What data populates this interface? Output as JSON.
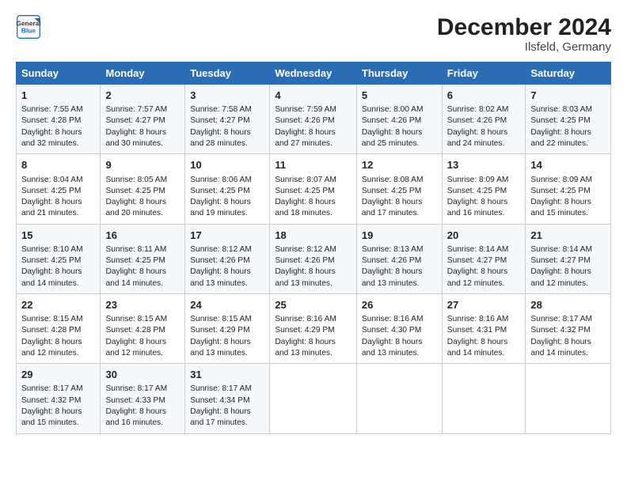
{
  "header": {
    "logo_line1": "General",
    "logo_line2": "Blue",
    "title": "December 2024",
    "subtitle": "Ilsfeld, Germany"
  },
  "calendar": {
    "days_of_week": [
      "Sunday",
      "Monday",
      "Tuesday",
      "Wednesday",
      "Thursday",
      "Friday",
      "Saturday"
    ],
    "weeks": [
      [
        {
          "day": "1",
          "lines": [
            "Sunrise: 7:55 AM",
            "Sunset: 4:28 PM",
            "Daylight: 8 hours",
            "and 32 minutes."
          ]
        },
        {
          "day": "2",
          "lines": [
            "Sunrise: 7:57 AM",
            "Sunset: 4:27 PM",
            "Daylight: 8 hours",
            "and 30 minutes."
          ]
        },
        {
          "day": "3",
          "lines": [
            "Sunrise: 7:58 AM",
            "Sunset: 4:27 PM",
            "Daylight: 8 hours",
            "and 28 minutes."
          ]
        },
        {
          "day": "4",
          "lines": [
            "Sunrise: 7:59 AM",
            "Sunset: 4:26 PM",
            "Daylight: 8 hours",
            "and 27 minutes."
          ]
        },
        {
          "day": "5",
          "lines": [
            "Sunrise: 8:00 AM",
            "Sunset: 4:26 PM",
            "Daylight: 8 hours",
            "and 25 minutes."
          ]
        },
        {
          "day": "6",
          "lines": [
            "Sunrise: 8:02 AM",
            "Sunset: 4:26 PM",
            "Daylight: 8 hours",
            "and 24 minutes."
          ]
        },
        {
          "day": "7",
          "lines": [
            "Sunrise: 8:03 AM",
            "Sunset: 4:25 PM",
            "Daylight: 8 hours",
            "and 22 minutes."
          ]
        }
      ],
      [
        {
          "day": "8",
          "lines": [
            "Sunrise: 8:04 AM",
            "Sunset: 4:25 PM",
            "Daylight: 8 hours",
            "and 21 minutes."
          ]
        },
        {
          "day": "9",
          "lines": [
            "Sunrise: 8:05 AM",
            "Sunset: 4:25 PM",
            "Daylight: 8 hours",
            "and 20 minutes."
          ]
        },
        {
          "day": "10",
          "lines": [
            "Sunrise: 8:06 AM",
            "Sunset: 4:25 PM",
            "Daylight: 8 hours",
            "and 19 minutes."
          ]
        },
        {
          "day": "11",
          "lines": [
            "Sunrise: 8:07 AM",
            "Sunset: 4:25 PM",
            "Daylight: 8 hours",
            "and 18 minutes."
          ]
        },
        {
          "day": "12",
          "lines": [
            "Sunrise: 8:08 AM",
            "Sunset: 4:25 PM",
            "Daylight: 8 hours",
            "and 17 minutes."
          ]
        },
        {
          "day": "13",
          "lines": [
            "Sunrise: 8:09 AM",
            "Sunset: 4:25 PM",
            "Daylight: 8 hours",
            "and 16 minutes."
          ]
        },
        {
          "day": "14",
          "lines": [
            "Sunrise: 8:09 AM",
            "Sunset: 4:25 PM",
            "Daylight: 8 hours",
            "and 15 minutes."
          ]
        }
      ],
      [
        {
          "day": "15",
          "lines": [
            "Sunrise: 8:10 AM",
            "Sunset: 4:25 PM",
            "Daylight: 8 hours",
            "and 14 minutes."
          ]
        },
        {
          "day": "16",
          "lines": [
            "Sunrise: 8:11 AM",
            "Sunset: 4:25 PM",
            "Daylight: 8 hours",
            "and 14 minutes."
          ]
        },
        {
          "day": "17",
          "lines": [
            "Sunrise: 8:12 AM",
            "Sunset: 4:26 PM",
            "Daylight: 8 hours",
            "and 13 minutes."
          ]
        },
        {
          "day": "18",
          "lines": [
            "Sunrise: 8:12 AM",
            "Sunset: 4:26 PM",
            "Daylight: 8 hours",
            "and 13 minutes."
          ]
        },
        {
          "day": "19",
          "lines": [
            "Sunrise: 8:13 AM",
            "Sunset: 4:26 PM",
            "Daylight: 8 hours",
            "and 13 minutes."
          ]
        },
        {
          "day": "20",
          "lines": [
            "Sunrise: 8:14 AM",
            "Sunset: 4:27 PM",
            "Daylight: 8 hours",
            "and 12 minutes."
          ]
        },
        {
          "day": "21",
          "lines": [
            "Sunrise: 8:14 AM",
            "Sunset: 4:27 PM",
            "Daylight: 8 hours",
            "and 12 minutes."
          ]
        }
      ],
      [
        {
          "day": "22",
          "lines": [
            "Sunrise: 8:15 AM",
            "Sunset: 4:28 PM",
            "Daylight: 8 hours",
            "and 12 minutes."
          ]
        },
        {
          "day": "23",
          "lines": [
            "Sunrise: 8:15 AM",
            "Sunset: 4:28 PM",
            "Daylight: 8 hours",
            "and 12 minutes."
          ]
        },
        {
          "day": "24",
          "lines": [
            "Sunrise: 8:15 AM",
            "Sunset: 4:29 PM",
            "Daylight: 8 hours",
            "and 13 minutes."
          ]
        },
        {
          "day": "25",
          "lines": [
            "Sunrise: 8:16 AM",
            "Sunset: 4:29 PM",
            "Daylight: 8 hours",
            "and 13 minutes."
          ]
        },
        {
          "day": "26",
          "lines": [
            "Sunrise: 8:16 AM",
            "Sunset: 4:30 PM",
            "Daylight: 8 hours",
            "and 13 minutes."
          ]
        },
        {
          "day": "27",
          "lines": [
            "Sunrise: 8:16 AM",
            "Sunset: 4:31 PM",
            "Daylight: 8 hours",
            "and 14 minutes."
          ]
        },
        {
          "day": "28",
          "lines": [
            "Sunrise: 8:17 AM",
            "Sunset: 4:32 PM",
            "Daylight: 8 hours",
            "and 14 minutes."
          ]
        }
      ],
      [
        {
          "day": "29",
          "lines": [
            "Sunrise: 8:17 AM",
            "Sunset: 4:32 PM",
            "Daylight: 8 hours",
            "and 15 minutes."
          ]
        },
        {
          "day": "30",
          "lines": [
            "Sunrise: 8:17 AM",
            "Sunset: 4:33 PM",
            "Daylight: 8 hours",
            "and 16 minutes."
          ]
        },
        {
          "day": "31",
          "lines": [
            "Sunrise: 8:17 AM",
            "Sunset: 4:34 PM",
            "Daylight: 8 hours",
            "and 17 minutes."
          ]
        },
        null,
        null,
        null,
        null
      ]
    ]
  }
}
